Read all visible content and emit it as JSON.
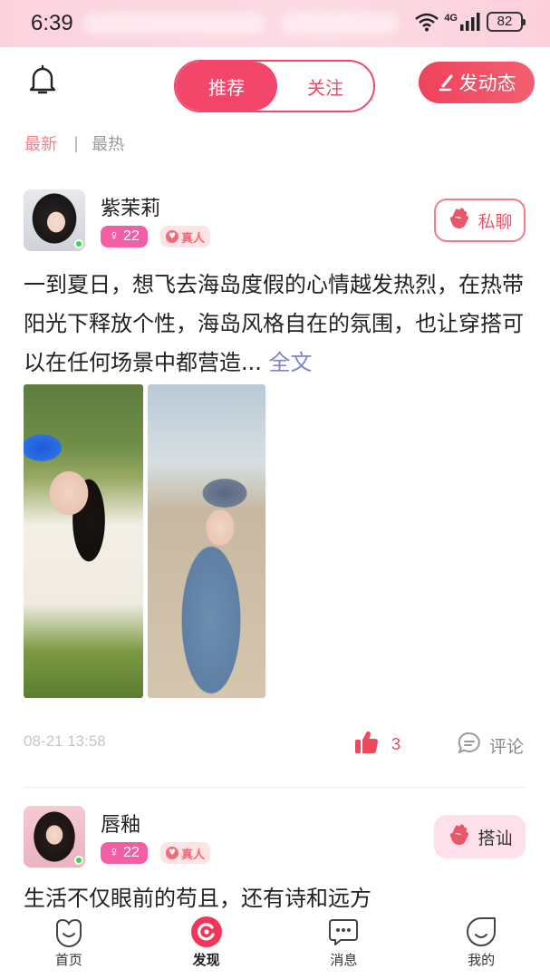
{
  "status_bar": {
    "time": "6:39",
    "network": "4G",
    "battery": "82"
  },
  "header": {
    "tabs": [
      {
        "label": "推荐",
        "active": true
      },
      {
        "label": "关注",
        "active": false
      }
    ],
    "post_button": "发动态"
  },
  "sort": {
    "latest": "最新",
    "separator": "|",
    "hot": "最热"
  },
  "posts": [
    {
      "username": "紫茉莉",
      "gender_symbol": "♀",
      "age": "22",
      "verified_label": "真人",
      "action_label": "私聊",
      "text": "一到夏日，想飞去海岛度假的心情越发热烈，在热带阳光下释放个性，海岛风格自在的氛围，也让穿搭可以在任何场景中都营造...",
      "more_link": "全文",
      "time": "08-21 13:58",
      "likes": "3",
      "comment_label": "评论"
    },
    {
      "username": "唇釉",
      "gender_symbol": "♀",
      "age": "22",
      "verified_label": "真人",
      "action_label": "搭讪",
      "text": "生活不仅眼前的苟且，还有诗和远方"
    }
  ],
  "bottom_nav": [
    {
      "label": "首页",
      "icon": "home-smile-icon",
      "active": false
    },
    {
      "label": "发现",
      "icon": "discover-icon",
      "active": true
    },
    {
      "label": "消息",
      "icon": "message-icon",
      "active": false
    },
    {
      "label": "我的",
      "icon": "profile-icon",
      "active": false
    }
  ],
  "colors": {
    "accent": "#f2476a",
    "status_bar_bg": "#fbd3df",
    "link": "#7e83d8",
    "age_badge": "#f25fa6",
    "online": "#3ed34e"
  }
}
